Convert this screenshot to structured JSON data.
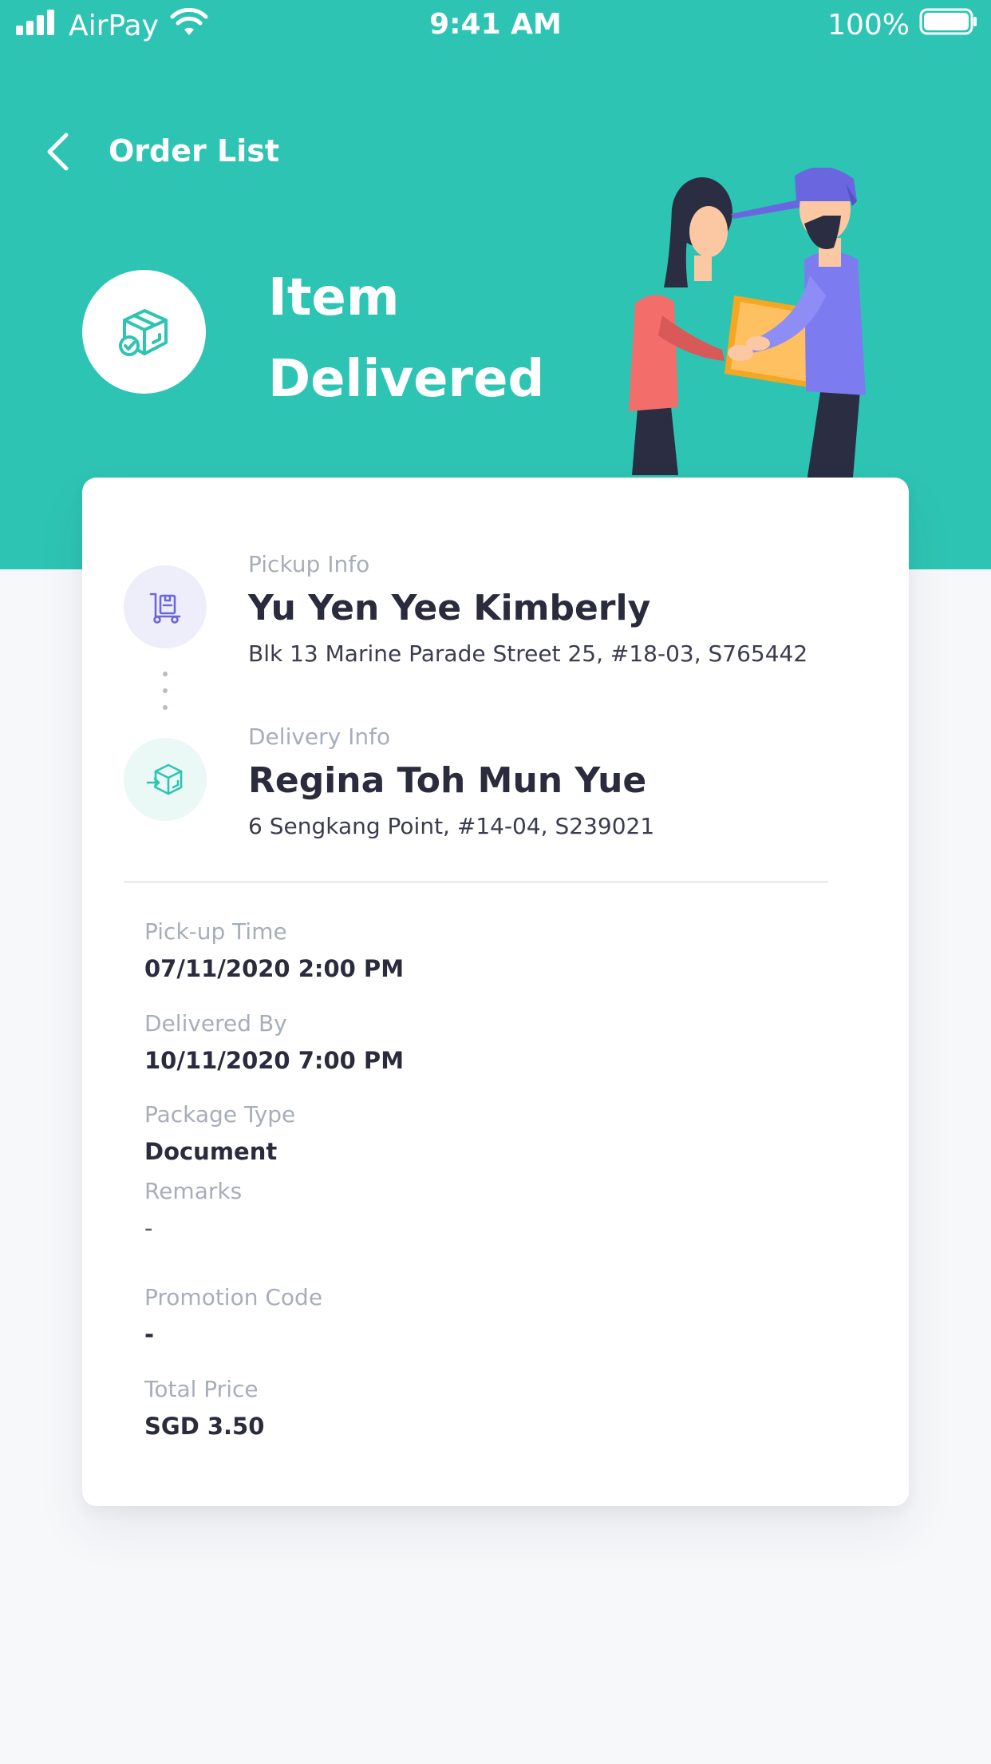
{
  "status_bar": {
    "carrier": "AirPay",
    "time": "9:41 AM",
    "battery": "100%",
    "icons": [
      "signal-icon",
      "wifi-icon",
      "battery-icon"
    ]
  },
  "nav": {
    "back_icon": "chevron-left-icon",
    "title": "Order List"
  },
  "hero": {
    "icon": "package-check-icon",
    "title_line1": "Item",
    "title_line2": "Delivered"
  },
  "pickup": {
    "icon": "hand-truck-icon",
    "label": "Pickup Info",
    "name": "Yu Yen Yee Kimberly",
    "address": "Blk 13 Marine Parade Street 25, #18-03, S765442"
  },
  "delivery": {
    "icon": "package-arrow-icon",
    "label": "Delivery Info",
    "name": "Regina Toh Mun Yue",
    "address": "6 Sengkang Point, #14-04, S239021"
  },
  "details": {
    "pickup_time": {
      "label": "Pick-up Time",
      "value": "07/11/2020 2:00 PM"
    },
    "delivered_by": {
      "label": "Delivered By",
      "value": "10/11/2020 7:00 PM"
    },
    "package_type": {
      "label": "Package Type",
      "value": "Document"
    },
    "remarks": {
      "label": "Remarks",
      "value": "-"
    },
    "promotion_code": {
      "label": "Promotion Code",
      "value": "-"
    },
    "total_price": {
      "label": "Total Price",
      "value": "SGD 3.50"
    }
  },
  "colors": {
    "teal": "#2ec4b3",
    "background": "#f7f8fa",
    "purple_accent": "#6a66e0",
    "text_dark": "#2a2b3d",
    "text_muted": "#a7aeb9"
  }
}
